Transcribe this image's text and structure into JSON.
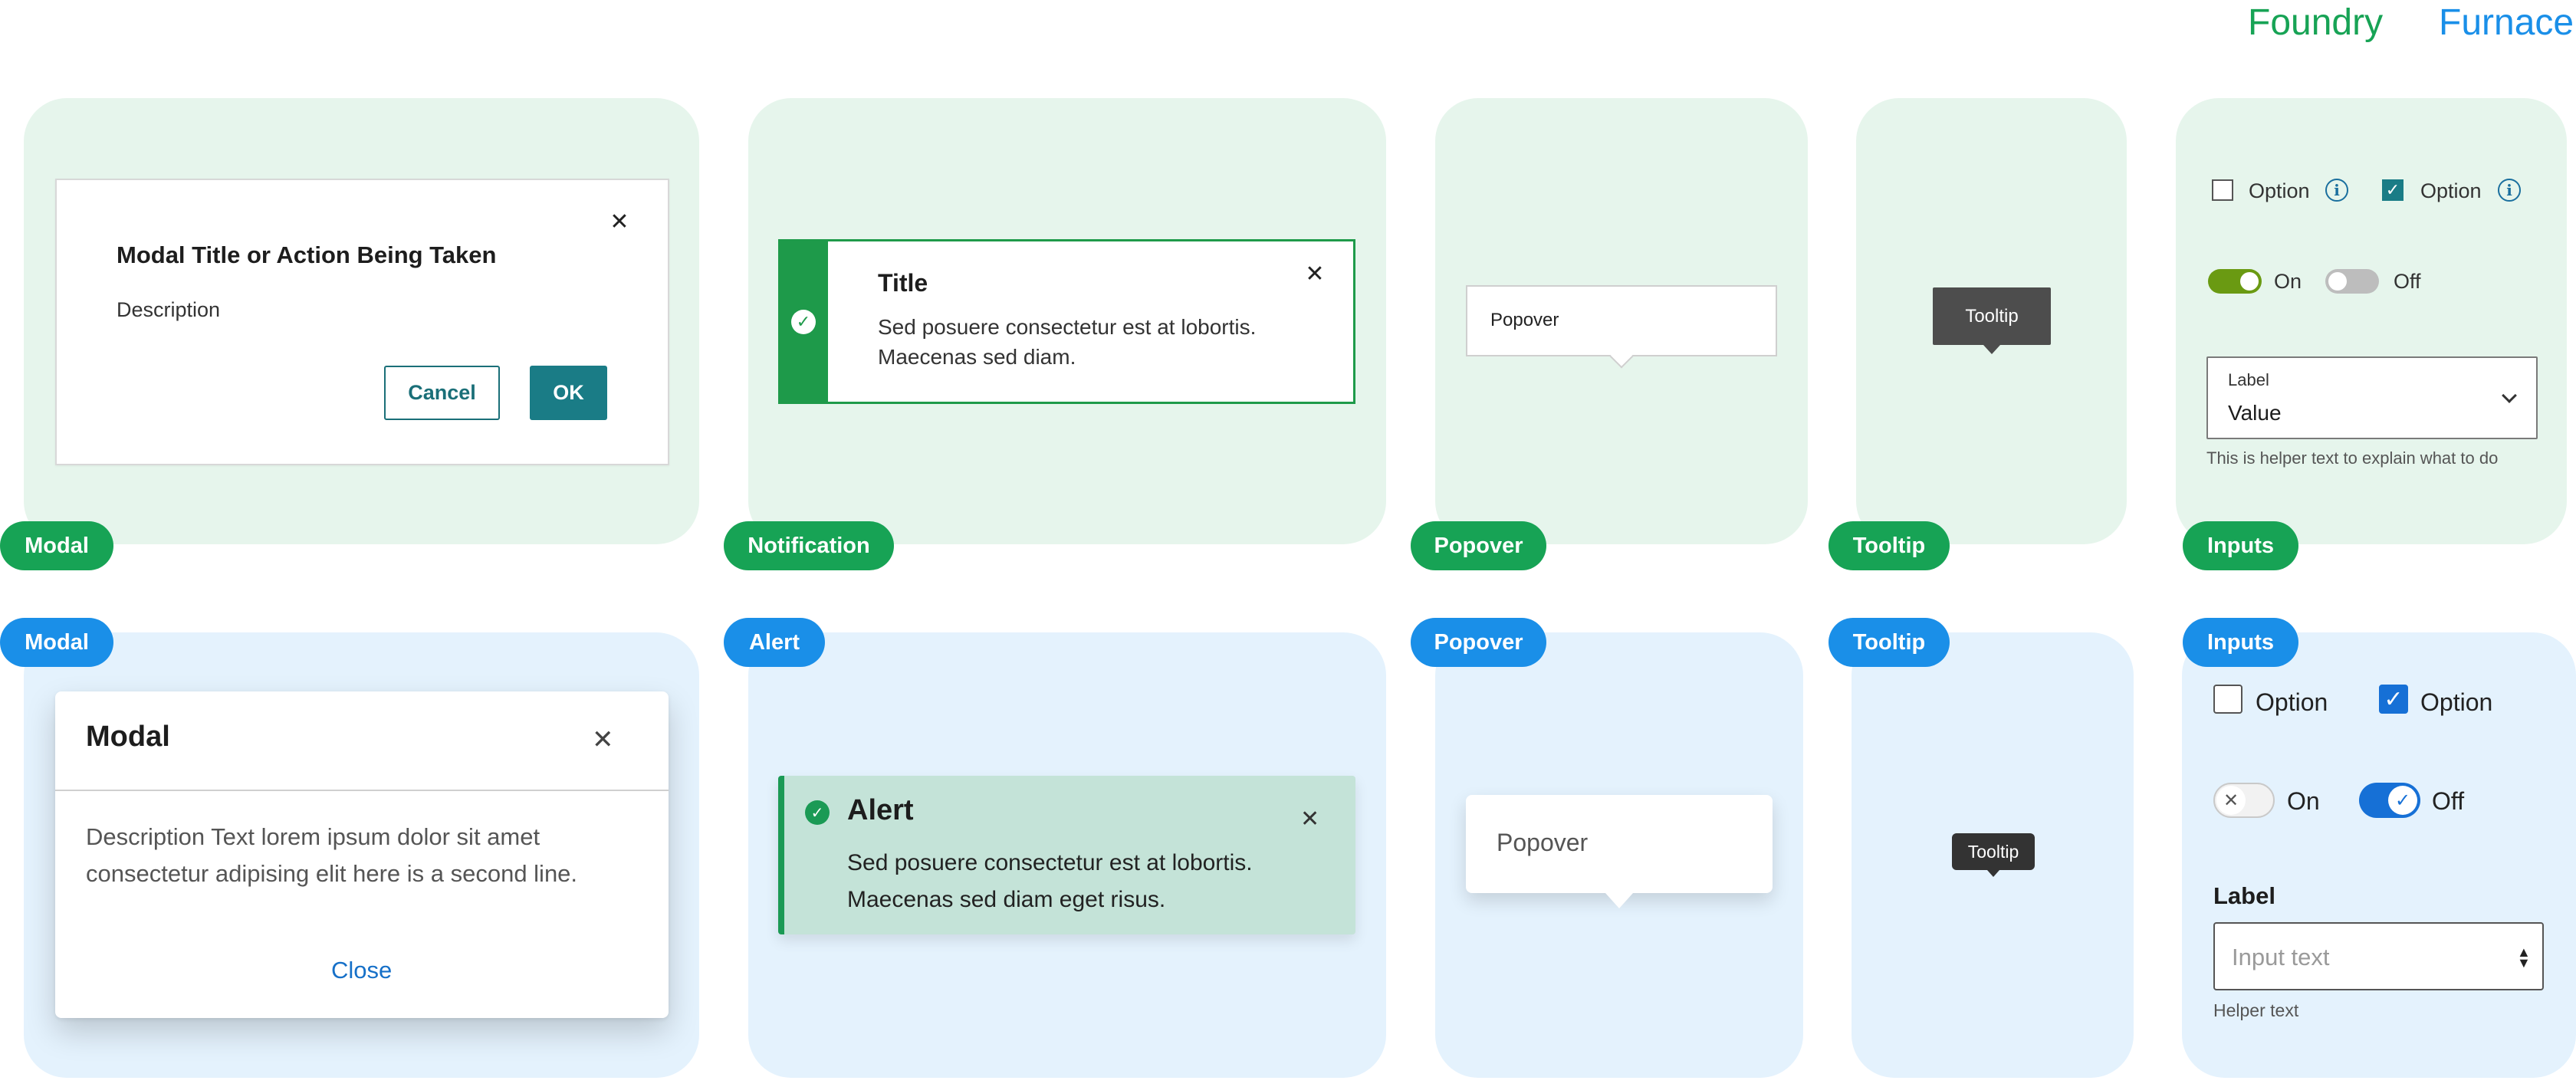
{
  "header": {
    "foundry": "Foundry",
    "furnace": "Furnace"
  },
  "colors": {
    "foundry_green": "#17a355",
    "furnace_blue": "#1a8fe8",
    "foundry_teal": "#1a7c86",
    "furnace_primary": "#1670d6"
  },
  "foundry": {
    "tags": {
      "modal": "Modal",
      "notification": "Notification",
      "popover": "Popover",
      "tooltip": "Tooltip",
      "inputs": "Inputs"
    },
    "modal": {
      "title": "Modal Title or Action Being Taken",
      "description": "Description",
      "cancel": "Cancel",
      "ok": "OK",
      "close_icon": "close-icon"
    },
    "notification": {
      "title": "Title",
      "body": "Sed posuere consectetur est at lobortis. Maecenas sed diam.",
      "icon": "check-circle-icon"
    },
    "popover": {
      "text": "Popover"
    },
    "tooltip": {
      "text": "Tooltip"
    },
    "inputs": {
      "checkbox1": {
        "label": "Option",
        "checked": false
      },
      "checkbox2": {
        "label": "Option",
        "checked": true
      },
      "toggle_on": {
        "label": "On",
        "on": true
      },
      "toggle_off": {
        "label": "Off",
        "on": false
      },
      "select": {
        "label": "Label",
        "value": "Value",
        "helper": "This is helper text to explain what to do"
      }
    }
  },
  "furnace": {
    "tags": {
      "modal": "Modal",
      "alert": "Alert",
      "popover": "Popover",
      "tooltip": "Tooltip",
      "inputs": "Inputs"
    },
    "modal": {
      "title": "Modal",
      "description": "Description Text lorem ipsum dolor sit amet consectetur adipising elit here is a second line.",
      "close": "Close"
    },
    "alert": {
      "title": "Alert",
      "body": "Sed posuere consectetur est at lobortis. Maecenas sed diam eget risus."
    },
    "popover": {
      "text": "Popover"
    },
    "tooltip": {
      "text": "Tooltip"
    },
    "inputs": {
      "checkbox1": {
        "label": "Option",
        "checked": false
      },
      "checkbox2": {
        "label": "Option",
        "checked": true
      },
      "toggle1": {
        "label": "On",
        "on": false
      },
      "toggle2": {
        "label": "Off",
        "on": true
      },
      "field": {
        "label": "Label",
        "placeholder": "Input text",
        "helper": "Helper text"
      }
    }
  }
}
